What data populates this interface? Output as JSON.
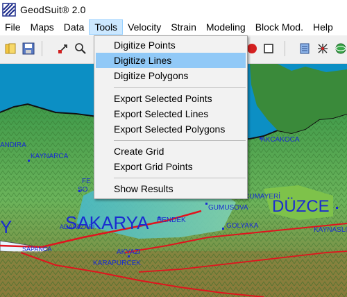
{
  "window": {
    "title": "GeodSuit® 2.0",
    "icon": "geodsuit-logo-icon"
  },
  "menubar": {
    "items": [
      {
        "label": "File"
      },
      {
        "label": "Maps"
      },
      {
        "label": "Data"
      },
      {
        "label": "Tools",
        "active": true
      },
      {
        "label": "Velocity"
      },
      {
        "label": "Strain"
      },
      {
        "label": "Modeling"
      },
      {
        "label": "Block Mod."
      },
      {
        "label": "Help"
      }
    ]
  },
  "tools_menu": {
    "items": [
      {
        "label": "Digitize Points"
      },
      {
        "label": "Digitize Lines",
        "highlighted": true
      },
      {
        "label": "Digitize Polygons"
      },
      {
        "label": "Export Selected Points"
      },
      {
        "label": "Export Selected Lines"
      },
      {
        "label": "Export Selected Polygons"
      },
      {
        "label": "Create Grid"
      },
      {
        "label": "Export Grid Points"
      },
      {
        "label": "Show Results"
      }
    ]
  },
  "toolbar": {
    "icons": [
      "open-folder-icon",
      "save-icon",
      "pan-cursor-icon",
      "zoom-icon",
      "stop-icon",
      "square-select-icon",
      "layers-icon",
      "network-icon",
      "globe-icon"
    ]
  },
  "map": {
    "labels": {
      "sakarya": "SAKARYA",
      "duzce": "DÜZCE",
      "kaynarca": "KAYNARCA",
      "akcakoca": "AKCAKOCA",
      "cumayeri": "CUMAYERİ",
      "gumusova": "GUMUSOVA",
      "hendek": "HENDEK",
      "golyaka": "GOLYAKA",
      "akyazi": "AKYAZI",
      "karapurcek": "KARAPURCEK",
      "sapanca": "SAPANCA",
      "adapazari": "ADAPAZARI",
      "kaynasli": "KAYNASLI",
      "andira": "ANDIRA",
      "ferizli": "FE",
      "sogutlu": "SO",
      "left_big": "Y"
    },
    "colors": {
      "sea": "#0a8fc0",
      "land": "#5fae52",
      "fault": "#e0141e",
      "label": "#1a2cd0"
    }
  }
}
